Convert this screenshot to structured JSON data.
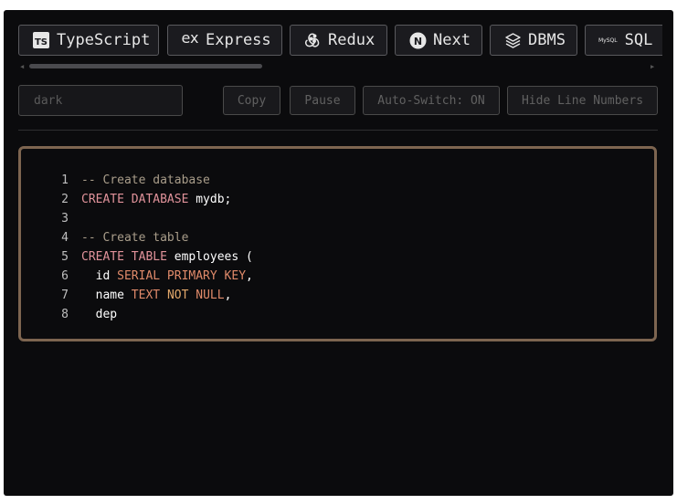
{
  "tabs": [
    {
      "label": "TypeScript",
      "icon": "typescript-icon",
      "badge": "TS"
    },
    {
      "label": "Express",
      "icon": "express-icon",
      "badge": "ex"
    },
    {
      "label": "Redux",
      "icon": "redux-icon"
    },
    {
      "label": "Next",
      "icon": "nextjs-icon",
      "badge": "N"
    },
    {
      "label": "DBMS",
      "icon": "layers-icon"
    },
    {
      "label": "SQL",
      "icon": "mysql-icon",
      "badge": "MySQL"
    }
  ],
  "controls": {
    "theme_placeholder": "dark",
    "copy_label": "Copy",
    "pause_label": "Pause",
    "auto_switch_label": "Auto-Switch: ON",
    "line_numbers_label": "Hide Line Numbers"
  },
  "code": {
    "lines": [
      {
        "n": "1",
        "tokens": [
          {
            "t": "-- Create database",
            "k": "comment"
          }
        ]
      },
      {
        "n": "2",
        "tokens": [
          {
            "t": "CREATE DATABASE",
            "k": "keyword"
          },
          {
            "t": " mydb;",
            "k": "ident"
          }
        ]
      },
      {
        "n": "3",
        "tokens": []
      },
      {
        "n": "4",
        "tokens": [
          {
            "t": "-- Create table",
            "k": "comment"
          }
        ]
      },
      {
        "n": "5",
        "tokens": [
          {
            "t": "CREATE TABLE",
            "k": "keyword"
          },
          {
            "t": " employees (",
            "k": "ident"
          }
        ]
      },
      {
        "n": "6",
        "tokens": [
          {
            "t": "  id ",
            "k": "ident"
          },
          {
            "t": "SERIAL PRIMARY KEY",
            "k": "type"
          },
          {
            "t": ",",
            "k": "ident"
          }
        ]
      },
      {
        "n": "7",
        "tokens": [
          {
            "t": "  name ",
            "k": "ident"
          },
          {
            "t": "TEXT ",
            "k": "type"
          },
          {
            "t": "NOT",
            "k": "amber"
          },
          {
            "t": " NULL",
            "k": "type"
          },
          {
            "t": ",",
            "k": "ident"
          }
        ]
      },
      {
        "n": "8",
        "tokens": [
          {
            "t": "  dep",
            "k": "ident"
          }
        ]
      }
    ]
  },
  "colors": {
    "background": "#0b0b0d",
    "panel_border": "#7d6550",
    "comment": "#a99d8a",
    "keyword": "#e0929a"
  }
}
